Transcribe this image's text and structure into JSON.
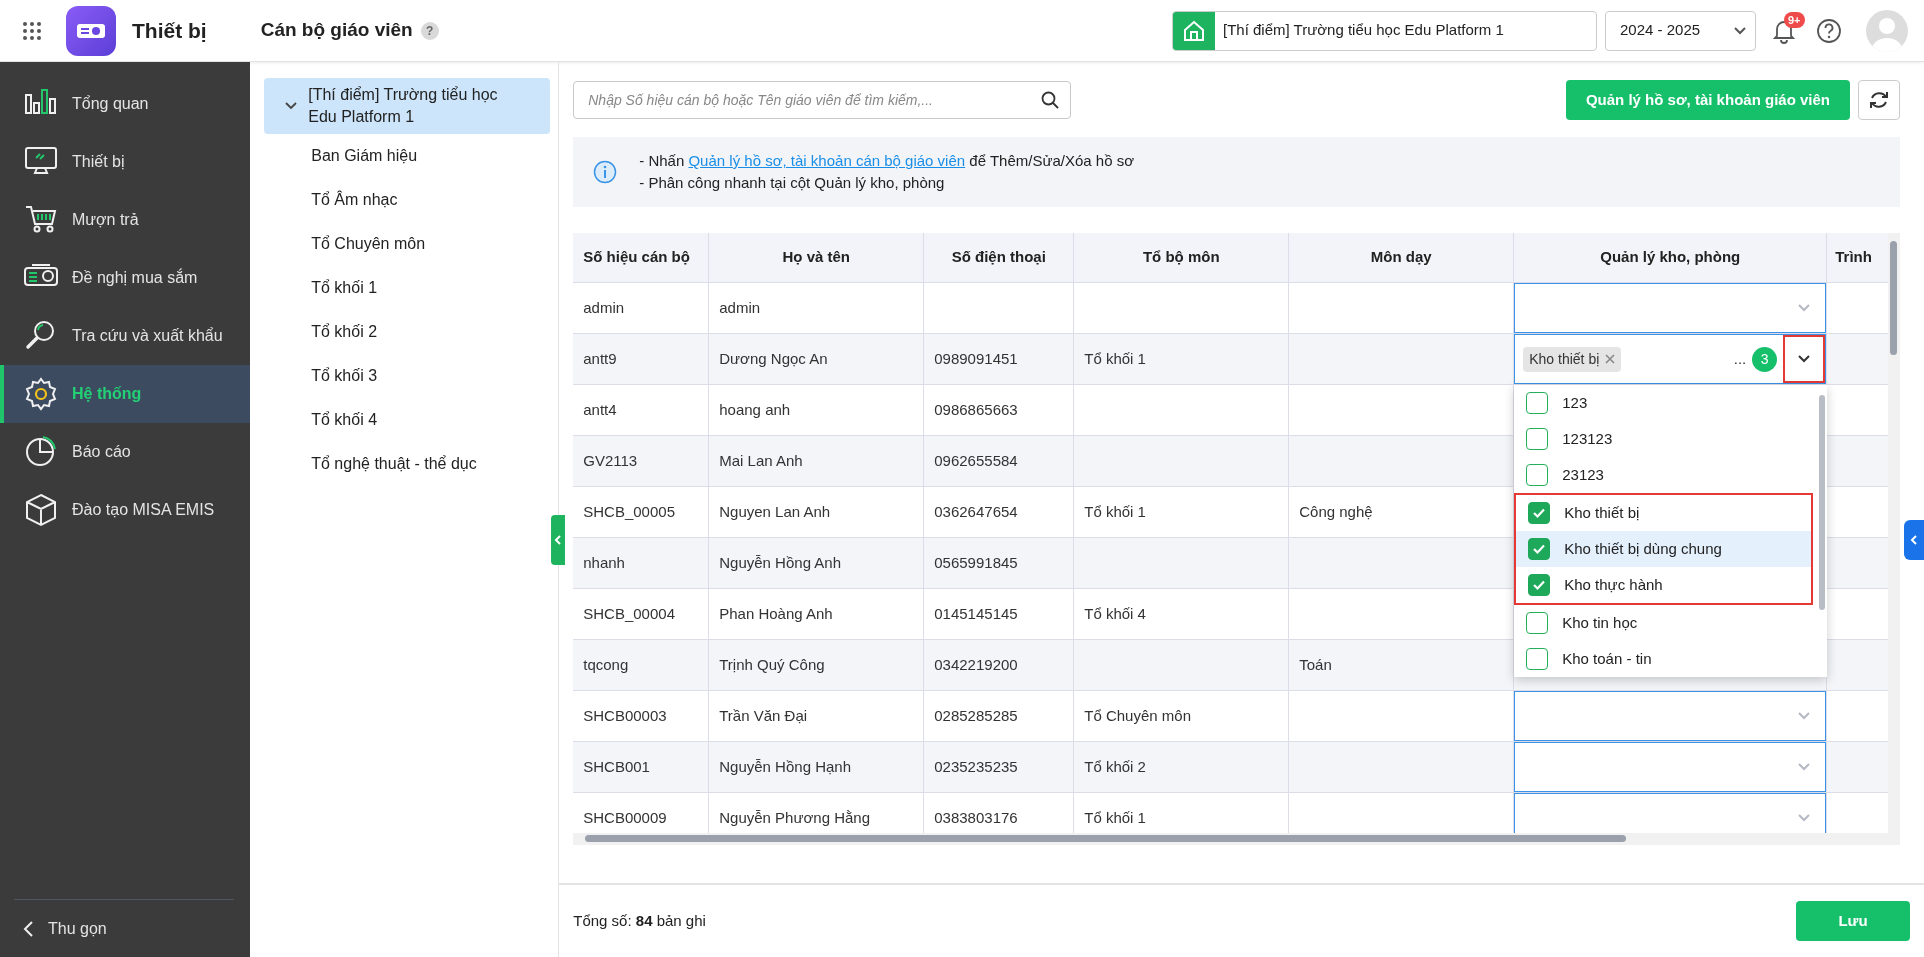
{
  "app": {
    "title": "Thiết bị"
  },
  "page": {
    "title": "Cán bộ giáo viên",
    "help": "?"
  },
  "school_picker": {
    "value": "[Thí điểm] Trường tiểu học Edu Platform 1"
  },
  "year_select": {
    "value": "2024 - 2025"
  },
  "notifications": {
    "badge": "9+"
  },
  "sidebar": {
    "items": [
      {
        "label": "Tổng quan",
        "selected": false
      },
      {
        "label": "Thiết bị",
        "selected": false
      },
      {
        "label": "Mượn trả",
        "selected": false
      },
      {
        "label": "Đề nghị mua sắm",
        "selected": false
      },
      {
        "label": "Tra cứu và xuất khẩu",
        "selected": false
      },
      {
        "label": "Hệ thống",
        "selected": true
      },
      {
        "label": "Báo cáo",
        "selected": false
      },
      {
        "label": "Đào tạo MISA EMIS",
        "selected": false
      }
    ],
    "collapse": "Thu gọn"
  },
  "tree": {
    "label": "[Thí điểm] Trường tiểu học Edu Platform 1",
    "expanded": true,
    "selected": true,
    "children": [
      {
        "label": "Ban Giám hiệu",
        "selected": false
      },
      {
        "label": "Tổ Âm nhạc",
        "selected": false
      },
      {
        "label": "Tổ Chuyên môn",
        "selected": false
      },
      {
        "label": "Tổ khối 1",
        "selected": false
      },
      {
        "label": "Tổ khối 2",
        "selected": false
      },
      {
        "label": "Tổ khối 3",
        "selected": false
      },
      {
        "label": "Tổ khối 4",
        "selected": false
      },
      {
        "label": "Tổ nghệ thuật - thể dục",
        "selected": false
      }
    ]
  },
  "search": {
    "placeholder": "Nhập Số hiệu cán bộ hoặc Tên giáo viên để tìm kiếm,..."
  },
  "manage_button": "Quản lý hồ sơ, tài khoản giáo viên",
  "info": {
    "lines": [
      {
        "before": "- Nhấn",
        "link": "Quản lý hồ sơ, tài khoản cán bộ giáo viên",
        "after": "để Thêm/Sửa/Xóa hồ sơ"
      },
      {
        "before": "- Phân công nhanh tại cột Quản lý kho, phòng"
      }
    ]
  },
  "table": {
    "columns": [
      "Số hiệu cán bộ",
      "Họ và tên",
      "Số điện thoại",
      "Tổ bộ môn",
      "Môn dạy",
      "Quản lý kho, phòng",
      "Trình"
    ],
    "rows": [
      {
        "id": "admin",
        "name": "admin",
        "store_picker": {
          "open": false
        }
      },
      {
        "id": "antt9",
        "name": "Dương Ngọc An",
        "phone": "0989091451",
        "group": "Tổ khối 1",
        "store_picker": {
          "open": true,
          "boxed": true,
          "tags": [
            "Kho thiết bị"
          ],
          "more": "...",
          "count": "3",
          "options": [
            {
              "label": "123",
              "checked": false,
              "highlighted": false,
              "boxed": false
            },
            {
              "label": "123123",
              "checked": false,
              "highlighted": false,
              "boxed": false
            },
            {
              "label": "23123",
              "checked": false,
              "highlighted": false,
              "boxed": false
            },
            {
              "label": "Kho thiết bị",
              "checked": true,
              "highlighted": false,
              "boxed": true
            },
            {
              "label": "Kho thiết bị dùng chung",
              "checked": true,
              "highlighted": true,
              "boxed": true
            },
            {
              "label": "Kho thực hành",
              "checked": true,
              "highlighted": false,
              "boxed": true
            },
            {
              "label": "Kho tin học",
              "checked": false,
              "highlighted": false,
              "boxed": false
            },
            {
              "label": "Kho toán - tin",
              "checked": false,
              "highlighted": false,
              "boxed": false
            }
          ]
        }
      },
      {
        "id": "antt4",
        "name": "hoang anh",
        "phone": "0986865663"
      },
      {
        "id": "GV2113",
        "name": "Mai Lan Anh",
        "phone": "0962655584"
      },
      {
        "id": "SHCB_00005",
        "name": "Nguyen Lan Anh",
        "phone": "0362647654",
        "group": "Tổ khối 1",
        "subject": "Công nghệ"
      },
      {
        "id": "nhanh",
        "name": "Nguyễn Hồng Anh",
        "phone": "0565991845"
      },
      {
        "id": "SHCB_00004",
        "name": "Phan Hoàng Anh",
        "phone": "0145145145",
        "group": "Tổ khối 4"
      },
      {
        "id": "tqcong",
        "name": "Trịnh Quý Công",
        "phone": "0342219200",
        "subject": "Toán"
      },
      {
        "id": "SHCB00003",
        "name": "Trần Văn Đại",
        "phone": "0285285285",
        "group": "Tổ Chuyên môn",
        "store_picker": {
          "open": false
        }
      },
      {
        "id": "SHCB001",
        "name": "Nguyễn Hồng Hạnh",
        "phone": "0235235235",
        "group": "Tổ khối 2",
        "store_picker": {
          "open": false
        }
      },
      {
        "id": "SHCB00009",
        "name": "Nguyễn Phương Hằng",
        "phone": "0383803176",
        "group": "Tổ khối 1",
        "store_picker": {
          "open": false
        }
      }
    ]
  },
  "footer": {
    "total": "Tổng số: **84** bản ghi",
    "save": "Lưu"
  }
}
